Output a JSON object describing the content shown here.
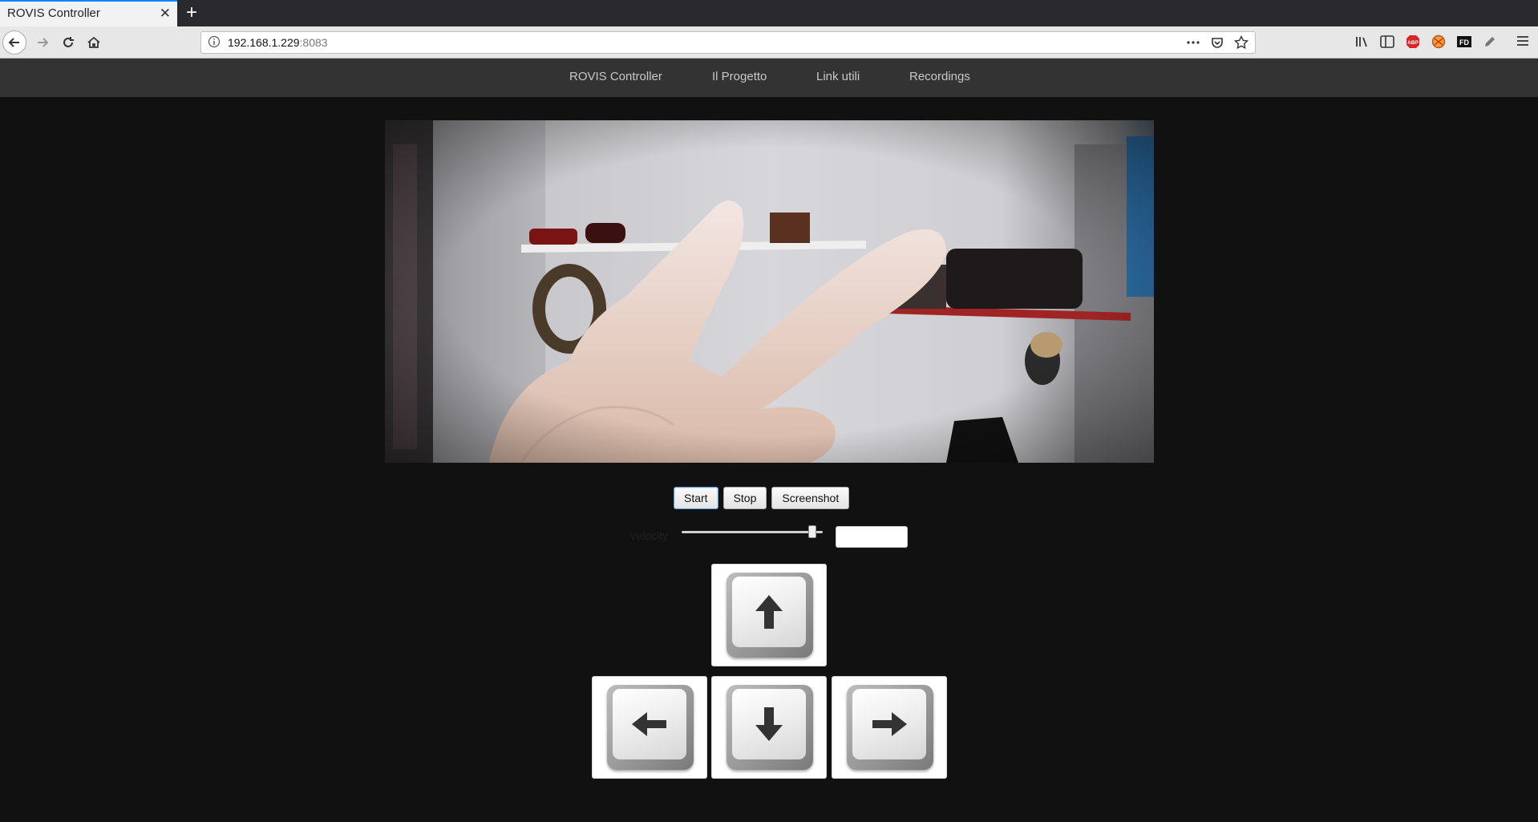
{
  "browser": {
    "tab_title": "ROVIS Controller",
    "url_host": "192.168.1.229",
    "url_port": ":8083",
    "icons": [
      "back-icon",
      "forward-icon",
      "reload-icon",
      "home-icon",
      "info-icon",
      "more-icon",
      "pocket-icon",
      "bookmark-star-icon",
      "library-icon",
      "sidebar-icon",
      "adblock-icon",
      "extension-icon",
      "fd-icon",
      "pen-icon",
      "menu-icon"
    ],
    "adblock_label": "ABP",
    "fd_label": "FD"
  },
  "site_nav": {
    "items": [
      "ROVIS Controller",
      "Il Progetto",
      "Link utili",
      "Recordings"
    ]
  },
  "controls": {
    "start_label": "Start",
    "stop_label": "Stop",
    "screenshot_label": "Screenshot",
    "velocity_label": "Velocity",
    "velocity_level_fraction": 0.95,
    "velocity_value": ""
  },
  "keys": {
    "up": "up-arrow-icon",
    "left": "left-arrow-icon",
    "down": "down-arrow-icon",
    "right": "right-arrow-icon"
  },
  "colors": {
    "page_bg": "#111111",
    "nav_bg": "#333333",
    "nav_text": "#c8c8c8"
  }
}
